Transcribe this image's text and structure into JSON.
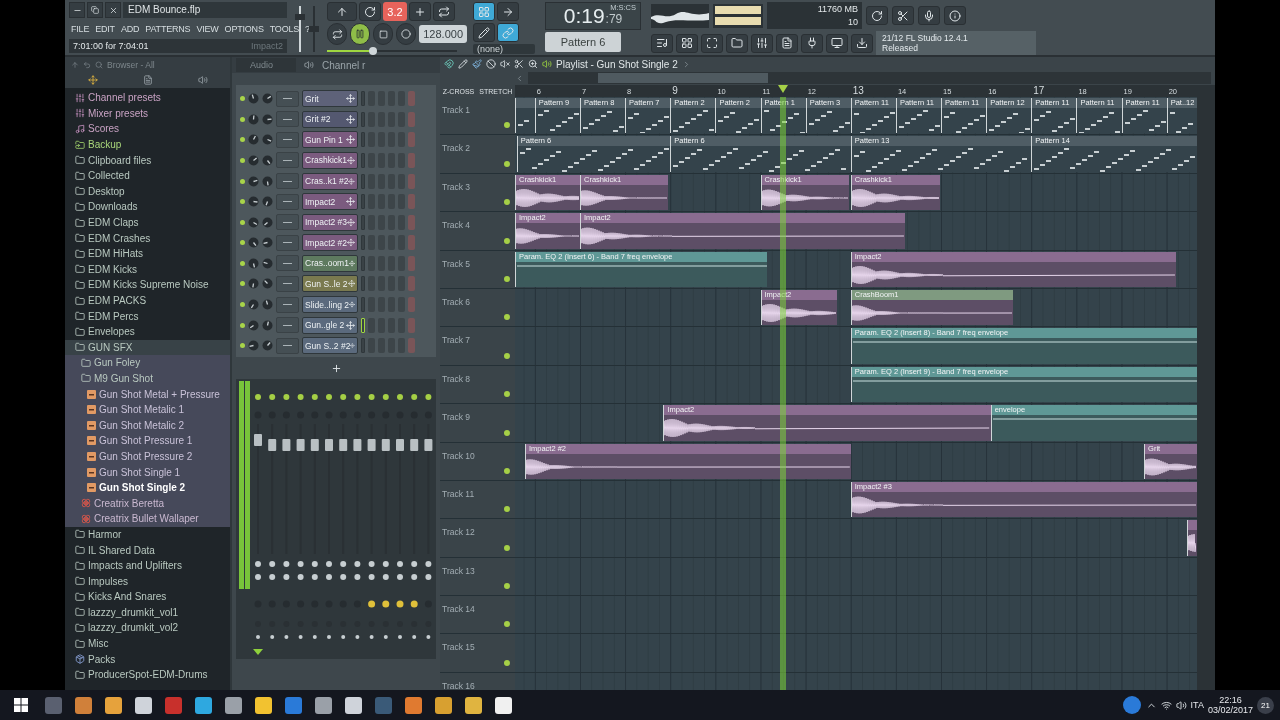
{
  "window": {
    "title": "EDM Bounce.flp"
  },
  "menu": [
    "FILE",
    "EDIT",
    "ADD",
    "PATTERNS",
    "VIEW",
    "OPTIONS",
    "TOOLS",
    "?"
  ],
  "hint_bar": {
    "text": "7:01:00 for 7:04:01",
    "channel": "Impact2"
  },
  "transport": {
    "step": "3.2",
    "playing": true,
    "tempo": "128.000",
    "snap": "(none)",
    "time": "0:19",
    "time_fraction": ":79",
    "time_unit": "M:S:CS",
    "pattern": "Pattern 6",
    "pitch": {
      "level": 0.35
    }
  },
  "cpu_panel": {
    "voices": "11",
    "memory": "760 MB",
    "polyphony": "10"
  },
  "news": {
    "counter": "21/12",
    "title": "FL Studio 12.4.1",
    "status": "Released"
  },
  "browser": {
    "title": "Browser - All",
    "items": [
      {
        "label": "Channel presets",
        "kind": "preset",
        "selected": false
      },
      {
        "label": "Mixer presets",
        "kind": "preset",
        "selected": false
      },
      {
        "label": "Scores",
        "kind": "score",
        "selected": false
      },
      {
        "label": "Backup",
        "kind": "backup",
        "selected": false
      },
      {
        "label": "Clipboard files",
        "kind": "folder",
        "selected": false
      },
      {
        "label": "Collected",
        "kind": "folder",
        "selected": false
      },
      {
        "label": "Desktop",
        "kind": "folder",
        "selected": false
      },
      {
        "label": "Downloads",
        "kind": "folder",
        "selected": false
      },
      {
        "label": "EDM Claps",
        "kind": "folder",
        "selected": false
      },
      {
        "label": "EDM Crashes",
        "kind": "folder",
        "selected": false
      },
      {
        "label": "EDM HiHats",
        "kind": "folder",
        "selected": false
      },
      {
        "label": "EDM Kicks",
        "kind": "folder",
        "selected": false
      },
      {
        "label": "EDM Kicks Supreme Noise",
        "kind": "folder",
        "selected": false
      },
      {
        "label": "EDM PACKS",
        "kind": "folder",
        "selected": false
      },
      {
        "label": "EDM Percs",
        "kind": "folder",
        "selected": false
      },
      {
        "label": "Envelopes",
        "kind": "folder",
        "selected": false
      },
      {
        "label": "GUN SFX",
        "kind": "folder",
        "selected": false,
        "children": [
          {
            "label": "Gun Foley",
            "kind": "folder",
            "selected": false
          },
          {
            "label": "M9 Gun Shot",
            "kind": "folder",
            "selected": false,
            "children": [
              {
                "label": "Gun Shot Metal + Pressure",
                "kind": "sample",
                "selected": false
              },
              {
                "label": "Gun Shot Metalic 1",
                "kind": "sample",
                "selected": false
              },
              {
                "label": "Gun Shot Metalic 2",
                "kind": "sample",
                "selected": false
              },
              {
                "label": "Gun Shot Pressure 1",
                "kind": "sample",
                "selected": false
              },
              {
                "label": "Gun Shot Pressure 2",
                "kind": "sample",
                "selected": false
              },
              {
                "label": "Gun Shot Single 1",
                "kind": "sample",
                "selected": false
              },
              {
                "label": "Gun Shot Single 2",
                "kind": "sample",
                "selected": true
              }
            ]
          },
          {
            "label": "Creatrix Beretta",
            "kind": "plugin",
            "selected": false
          },
          {
            "label": "Creatrix Bullet Wallaper",
            "kind": "plugin",
            "selected": false
          }
        ]
      },
      {
        "label": "Harmor",
        "kind": "folder",
        "selected": false
      },
      {
        "label": "IL Shared Data",
        "kind": "folder",
        "selected": false
      },
      {
        "label": "Impacts and Uplifters",
        "kind": "folder",
        "selected": false
      },
      {
        "label": "Impulses",
        "kind": "folder",
        "selected": false
      },
      {
        "label": "Kicks And Snares",
        "kind": "folder",
        "selected": false
      },
      {
        "label": "lazzzy_drumkit_vol1",
        "kind": "folder",
        "selected": false
      },
      {
        "label": "lazzzy_drumkit_vol2",
        "kind": "folder",
        "selected": false
      },
      {
        "label": "Misc",
        "kind": "folder",
        "selected": false
      },
      {
        "label": "Packs",
        "kind": "pack",
        "selected": false
      },
      {
        "label": "ProducerSpot-EDM-Drums",
        "kind": "folder",
        "selected": false
      }
    ]
  },
  "channel_rack": {
    "group": "Audio",
    "title": "Channel r",
    "channels": [
      {
        "name": "Grit",
        "color": "#5e6279",
        "selected": false
      },
      {
        "name": "Grit #2",
        "color": "#545870",
        "selected": false
      },
      {
        "name": "Gun Pin 1",
        "color": "#7b5b7f",
        "selected": false
      },
      {
        "name": "Crashkick1",
        "color": "#7b5b7f",
        "selected": false
      },
      {
        "name": "Cras..k1 #2",
        "color": "#7b5b7f",
        "selected": false
      },
      {
        "name": "Impact2",
        "color": "#7b5b7f",
        "selected": false
      },
      {
        "name": "Impact2 #3",
        "color": "#7b5b7f",
        "selected": false
      },
      {
        "name": "Impact2 #2",
        "color": "#7b5b7f",
        "selected": false
      },
      {
        "name": "Cras..oom1",
        "color": "#5e7a5f",
        "selected": false
      },
      {
        "name": "Gun S..le 2",
        "color": "#7a7a4f",
        "selected": false
      },
      {
        "name": "Slide..ling 2",
        "color": "#5b6a7d",
        "selected": false
      },
      {
        "name": "Gun..gle 2",
        "color": "#5b6a7d",
        "selected": true
      },
      {
        "name": "Gun S..2 #2",
        "color": "#5b6a7d",
        "selected": false
      }
    ]
  },
  "playlist": {
    "title": "Playlist - Gun Shot Single 2",
    "lane_header": [
      "Z-CROSS",
      "STRETCH"
    ],
    "ruler": [
      "6",
      "7",
      "8",
      "9",
      "10",
      "11",
      "12",
      "13",
      "14",
      "15",
      "16",
      "17",
      "18",
      "19",
      "20"
    ],
    "tracks": [
      {
        "name": "Track 1",
        "clips": [
          {
            "kind": "pattern",
            "color": "#4f5d65"
          },
          {
            "kind": "pattern",
            "label": "Pattern 9",
            "color": "#4f5d65"
          },
          {
            "kind": "pattern",
            "label": "Pattern 8",
            "color": "#4f5d65"
          },
          {
            "kind": "pattern",
            "label": "Pattern 7",
            "color": "#4f5d65"
          },
          {
            "kind": "pattern",
            "label": "Pattern 2",
            "color": "#4f5d65"
          },
          {
            "kind": "pattern",
            "label": "Pattern 2",
            "color": "#4f5d65"
          },
          {
            "kind": "pattern",
            "label": "Pattern 1",
            "color": "#4f5d65"
          },
          {
            "kind": "pattern",
            "label": "Pattern 3",
            "color": "#4f5d65"
          },
          {
            "kind": "pattern",
            "label": "Pattern 11",
            "color": "#4f5d65"
          },
          {
            "kind": "pattern",
            "label": "Pattern 11",
            "color": "#4f5d65"
          },
          {
            "kind": "pattern",
            "label": "Pattern 11",
            "color": "#4f5d65"
          },
          {
            "kind": "pattern",
            "label": "Pattern 12",
            "color": "#4f5d65"
          },
          {
            "kind": "pattern",
            "label": "Pattern 11",
            "color": "#4f5d65"
          },
          {
            "kind": "pattern",
            "label": "Pattern 11",
            "color": "#4f5d65"
          },
          {
            "kind": "pattern",
            "label": "Pattern 11",
            "color": "#4f5d65"
          },
          {
            "kind": "pattern",
            "label": "Pat..12",
            "color": "#4f5d65"
          }
        ]
      },
      {
        "name": "Track 2",
        "clips": [
          {
            "kind": "pattern",
            "label": "Pattern 6",
            "color": "#4f5d65"
          },
          {
            "kind": "pattern",
            "label": "Pattern 6",
            "color": "#4f5d65"
          },
          {
            "kind": "pattern",
            "label": "Pattern 13",
            "color": "#4f5d65"
          },
          {
            "kind": "pattern",
            "label": "Pattern 14",
            "color": "#4f5d65"
          }
        ]
      },
      {
        "name": "Track 3",
        "clips": [
          {
            "kind": "audio",
            "label": "Crashkick1",
            "color": "#8a6c90"
          },
          {
            "kind": "audio",
            "label": "Crashkick1",
            "color": "#8a6c90"
          },
          {
            "kind": "audio",
            "label": "Crashkick1",
            "color": "#8a6c90"
          },
          {
            "kind": "audio",
            "label": "Crashkick1",
            "color": "#8a6c90"
          }
        ]
      },
      {
        "name": "Track 4",
        "clips": [
          {
            "kind": "audio",
            "label": "Impact2",
            "color": "#8a6c90"
          },
          {
            "kind": "audio",
            "label": "Impact2",
            "color": "#8a6c90"
          }
        ]
      },
      {
        "name": "Track 5",
        "clips": [
          {
            "kind": "automation",
            "label": "Param. EQ 2 (Insert 6) - Band 7 freq envelope",
            "color": "#5f9896"
          },
          {
            "kind": "audio",
            "label": "Impact2",
            "color": "#8a6c90"
          }
        ]
      },
      {
        "name": "Track 6",
        "clips": [
          {
            "kind": "audio",
            "label": "Impact2",
            "color": "#8a6c90"
          },
          {
            "kind": "audio",
            "label": "CrashBoom1",
            "color": "#7f9a80"
          }
        ]
      },
      {
        "name": "Track 7",
        "clips": [
          {
            "kind": "automation",
            "label": "Param. EQ 2 (Insert 8) - Band 7 freq envelope",
            "color": "#5f9896"
          }
        ]
      },
      {
        "name": "Track 8",
        "clips": [
          {
            "kind": "automation",
            "label": "Param. EQ 2 (Insert 9) - Band 7 freq envelope",
            "color": "#5f9896"
          }
        ]
      },
      {
        "name": "Track 9",
        "clips": [
          {
            "kind": "audio",
            "label": "Impact2",
            "color": "#8a6c90"
          },
          {
            "kind": "automation",
            "label": "envelope",
            "color": "#5f9896"
          }
        ]
      },
      {
        "name": "Track 10",
        "clips": [
          {
            "kind": "audio",
            "label": "Impact2 #2",
            "color": "#8a6c90"
          },
          {
            "kind": "audio",
            "label": "Grit",
            "color": "#8a6c90"
          }
        ]
      },
      {
        "name": "Track 11",
        "clips": [
          {
            "kind": "audio",
            "label": "Impact2 #3",
            "color": "#8a6c90"
          }
        ]
      },
      {
        "name": "Track 12",
        "clips": [
          {
            "kind": "audio",
            "color": "#8a6c90"
          }
        ]
      },
      {
        "name": "Track 13"
      },
      {
        "name": "Track 14"
      },
      {
        "name": "Track 15"
      },
      {
        "name": "Track 16"
      }
    ]
  },
  "taskbar": {
    "language": "ITA",
    "time": "22:16",
    "date": "03/02/2017",
    "notifications": "21"
  }
}
